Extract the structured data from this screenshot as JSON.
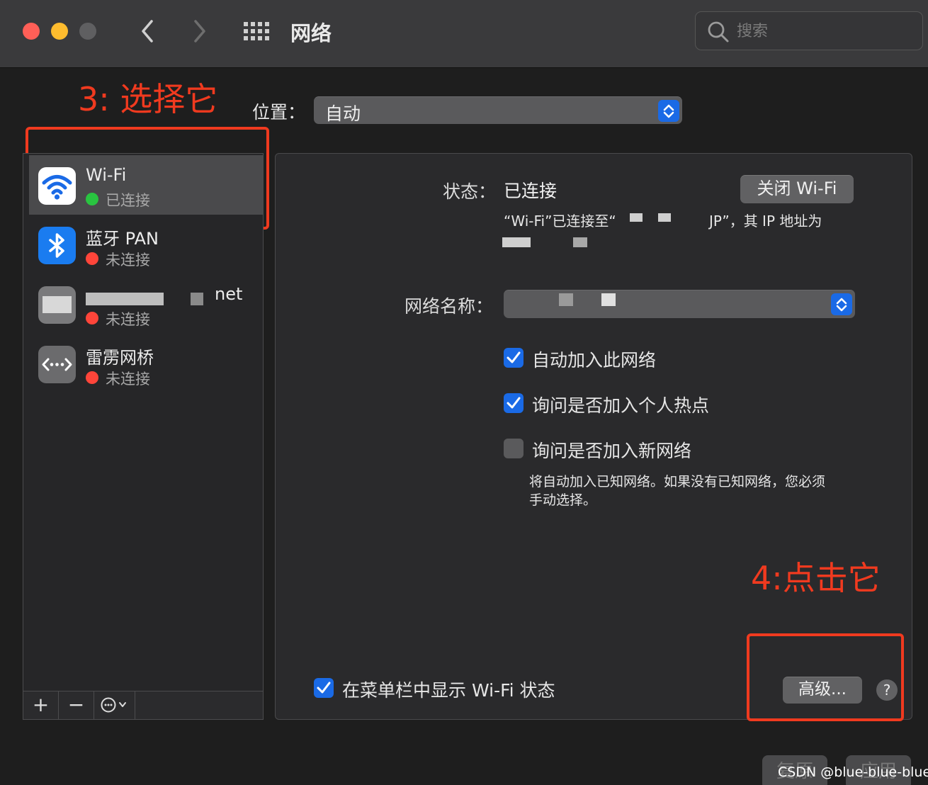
{
  "window": {
    "title": "网络",
    "search_placeholder": "搜索",
    "traffic_lights": {
      "close": "#ff5f57",
      "minimize": "#febc2e",
      "zoom": "#5f5f61"
    }
  },
  "annotations": {
    "step3": "3: 选择它",
    "step4": "4:点击它",
    "color": "#f03a1f"
  },
  "location": {
    "label": "位置：",
    "value": "自动"
  },
  "services": [
    {
      "name": "Wi-Fi",
      "status": "已连接",
      "status_color": "#29c440",
      "icon": "wifi-icon",
      "selected": true
    },
    {
      "name": "蓝牙 PAN",
      "status": "未连接",
      "status_color": "#ff453a",
      "icon": "bluetooth-icon",
      "selected": false
    },
    {
      "name": "net",
      "status": "未连接",
      "status_color": "#ff453a",
      "icon": "ethernet-icon",
      "selected": false
    },
    {
      "name": "雷雳网桥",
      "status": "未连接",
      "status_color": "#ff453a",
      "icon": "thunderbolt-bridge-icon",
      "selected": false
    }
  ],
  "sidebar_toolbar": {
    "add": "+",
    "remove": "−"
  },
  "detail": {
    "status_label": "状态：",
    "status_value": "已连接",
    "turn_off_wifi": "关闭 Wi-Fi",
    "status_desc_prefix": "“Wi-Fi”已连接至“",
    "status_desc_suffix": "JP”，其 IP 地址为",
    "network_name_label": "网络名称：",
    "checkboxes": [
      {
        "label": "自动加入此网络",
        "checked": true
      },
      {
        "label": "询问是否加入个人热点",
        "checked": true
      },
      {
        "label": "询问是否加入新网络",
        "checked": false
      }
    ],
    "new_network_hint_line1": "将自动加入已知网络。如果没有已知网络，您必须",
    "new_network_hint_line2": "手动选择。",
    "show_in_menubar": "在菜单栏中显示 Wi-Fi 状态",
    "show_in_menubar_checked": true,
    "advanced": "高级...",
    "help": "?"
  },
  "footer": {
    "revert": "复原",
    "apply": "应用"
  },
  "watermark": "CSDN @blue-blue-blue",
  "accent": "#1a6ae6"
}
